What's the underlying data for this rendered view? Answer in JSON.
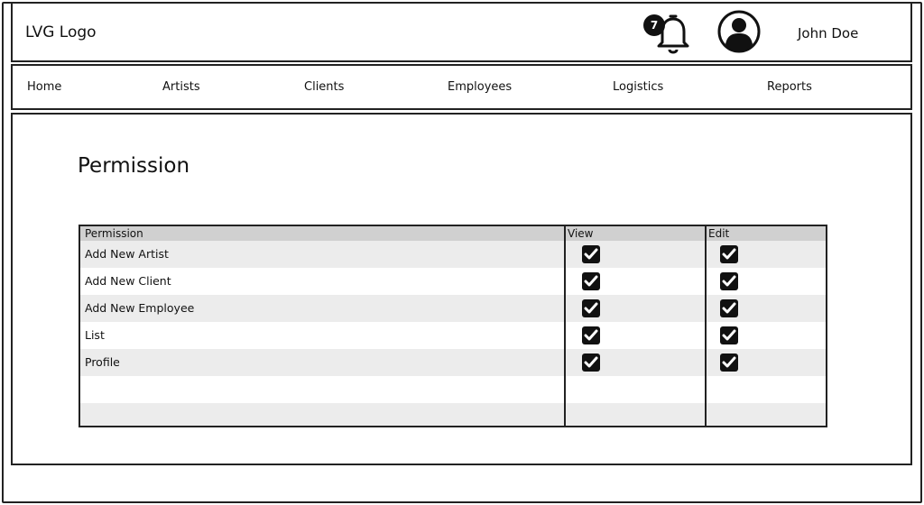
{
  "header": {
    "logo_text": "LVG Logo",
    "notification_count": "7",
    "user_name": "John Doe"
  },
  "nav": {
    "items": [
      {
        "label": "Home"
      },
      {
        "label": "Artists"
      },
      {
        "label": "Clients"
      },
      {
        "label": "Employees"
      },
      {
        "label": "Logistics"
      },
      {
        "label": "Reports"
      }
    ]
  },
  "main": {
    "title": "Permission",
    "table": {
      "columns": [
        "Permission",
        "View",
        "Edit"
      ],
      "rows": [
        {
          "label": "Add New Artist",
          "view": true,
          "edit": true
        },
        {
          "label": "Add New Client",
          "view": true,
          "edit": true
        },
        {
          "label": "Add New Employee",
          "view": true,
          "edit": true
        },
        {
          "label": "List",
          "view": true,
          "edit": true
        },
        {
          "label": "Profile",
          "view": true,
          "edit": true
        },
        {
          "label": "",
          "view": null,
          "edit": null
        },
        {
          "label": "",
          "view": null,
          "edit": null
        }
      ]
    }
  },
  "icons": {
    "bell": "bell-icon",
    "avatar": "user-avatar-icon",
    "check": "checkbox-checked-icon"
  },
  "colors": {
    "stroke": "#222222",
    "header_row": "#d0d0d0",
    "shaded_row": "#ececec",
    "check_fill": "#111111"
  }
}
